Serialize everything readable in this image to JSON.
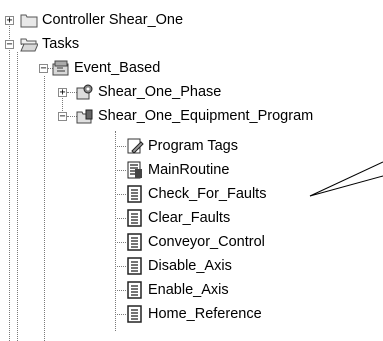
{
  "tree": {
    "controller": {
      "label": "Controller Shear_One",
      "expander": "+"
    },
    "tasks": {
      "label": "Tasks",
      "expander": "−"
    },
    "event_based": {
      "label": "Event_Based",
      "expander": "−"
    },
    "phase": {
      "label": "Shear_One_Phase",
      "expander": "+"
    },
    "program": {
      "label": "Shear_One_Equipment_Program",
      "expander": "−"
    },
    "children": [
      {
        "label": "Program Tags",
        "icon": "program-tags-icon"
      },
      {
        "label": "MainRoutine",
        "icon": "main-routine-icon"
      },
      {
        "label": "Check_For_Faults",
        "icon": "routine-icon"
      },
      {
        "label": "Clear_Faults",
        "icon": "routine-icon"
      },
      {
        "label": "Conveyor_Control",
        "icon": "routine-icon"
      },
      {
        "label": "Disable_Axis",
        "icon": "routine-icon"
      },
      {
        "label": "Enable_Axis",
        "icon": "routine-icon"
      },
      {
        "label": "Home_Reference",
        "icon": "routine-icon"
      }
    ]
  }
}
